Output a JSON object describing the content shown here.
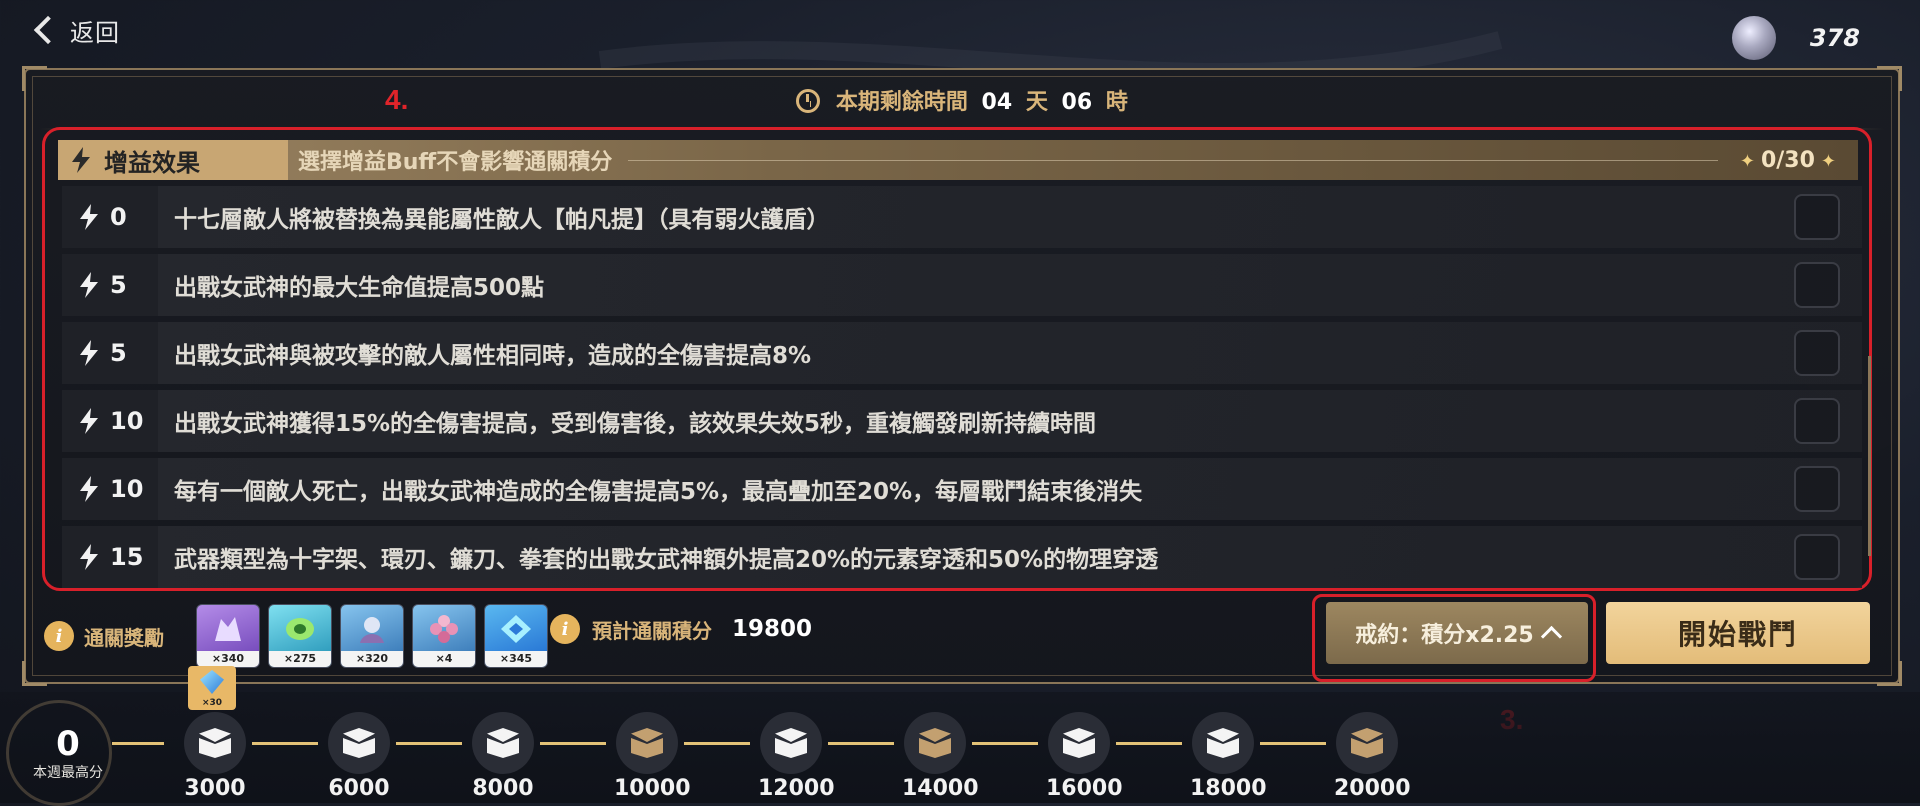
{
  "header": {
    "back_label": "返回",
    "currency_value": "378"
  },
  "timer": {
    "prefix": "本期剩餘時間",
    "days": "04",
    "days_unit": "天",
    "hours": "06",
    "hours_unit": "時"
  },
  "annotations": {
    "a4": "4.",
    "a3": "3."
  },
  "buff": {
    "title": "增益效果",
    "subtitle": "選擇增益Buff不會影響通關積分",
    "count": "0/30",
    "rows": [
      {
        "cost": "0",
        "text": "十七層敵人將被替換為異能屬性敵人【帕凡提】（具有弱火護盾）"
      },
      {
        "cost": "5",
        "text": "出戰女武神的最大生命值提高500點"
      },
      {
        "cost": "5",
        "text": "出戰女武神與被攻擊的敵人屬性相同時，造成的全傷害提高8%"
      },
      {
        "cost": "10",
        "text": "出戰女武神獲得15%的全傷害提高，受到傷害後，該效果失效5秒，重複觸發刷新持續時間"
      },
      {
        "cost": "10",
        "text": "每有一個敵人死亡，出戰女武神造成的全傷害提高5%，最高疊加至20%，每層戰鬥結束後消失"
      },
      {
        "cost": "15",
        "text": "武器類型為十字架、環刃、鐮刀、拳套的出戰女武神額外提高20%的元素穿透和50%的物理穿透"
      }
    ]
  },
  "rewards": {
    "label": "通關獎勵",
    "items": [
      {
        "count": "×340",
        "icon": "valkyrie-fragment-icon",
        "color": "#7a4fc1"
      },
      {
        "count": "×275",
        "icon": "coin-icon",
        "color": "#2aa8c9"
      },
      {
        "count": "×320",
        "icon": "avatar-fragment-icon",
        "color": "#3a86c8"
      },
      {
        "count": "×4",
        "icon": "flower-material-icon",
        "color": "#3a86c8"
      },
      {
        "count": "×345",
        "icon": "crystal-emblem-icon",
        "color": "#2a86d8"
      }
    ]
  },
  "score": {
    "label": "預計通關積分",
    "value": "19800"
  },
  "buttons": {
    "contract": "戒約：積分x2.25",
    "start": "開始戰鬥"
  },
  "progress": {
    "best_value": "0",
    "best_label": "本週最高分",
    "bonus_count": "×30",
    "milestones": [
      {
        "value": "3000",
        "kind": "white"
      },
      {
        "value": "6000",
        "kind": "white"
      },
      {
        "value": "8000",
        "kind": "white"
      },
      {
        "value": "10000",
        "kind": "gold"
      },
      {
        "value": "12000",
        "kind": "white"
      },
      {
        "value": "14000",
        "kind": "gold"
      },
      {
        "value": "16000",
        "kind": "white"
      },
      {
        "value": "18000",
        "kind": "white"
      },
      {
        "value": "20000",
        "kind": "gold"
      }
    ]
  }
}
